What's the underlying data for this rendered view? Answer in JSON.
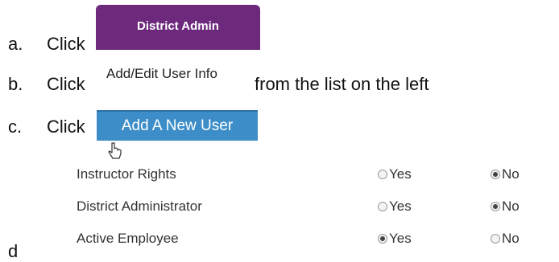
{
  "steps": [
    {
      "letter": "a.",
      "word": "Click"
    },
    {
      "letter": "b.",
      "word": "Click",
      "suffix": "from the list on the left"
    },
    {
      "letter": "c.",
      "word": "Click"
    },
    {
      "letter": "d"
    }
  ],
  "district_admin_button": {
    "label": "District Admin"
  },
  "add_edit_link": {
    "label": "Add/Edit User Info"
  },
  "add_new_user_button": {
    "label": "Add A New User"
  },
  "cursor_icon": "pointer-cursor-icon",
  "rights": [
    {
      "label": "Instructor Rights",
      "yes": "Yes",
      "no": "No",
      "selected": "no"
    },
    {
      "label": "District Administrator",
      "yes": "Yes",
      "no": "No",
      "selected": "no"
    },
    {
      "label": "Active Employee",
      "yes": "Yes",
      "no": "No",
      "selected": "yes"
    }
  ],
  "colors": {
    "district_admin_bg": "#6d2a7d",
    "add_new_user_bg": "#3c8dc8"
  }
}
